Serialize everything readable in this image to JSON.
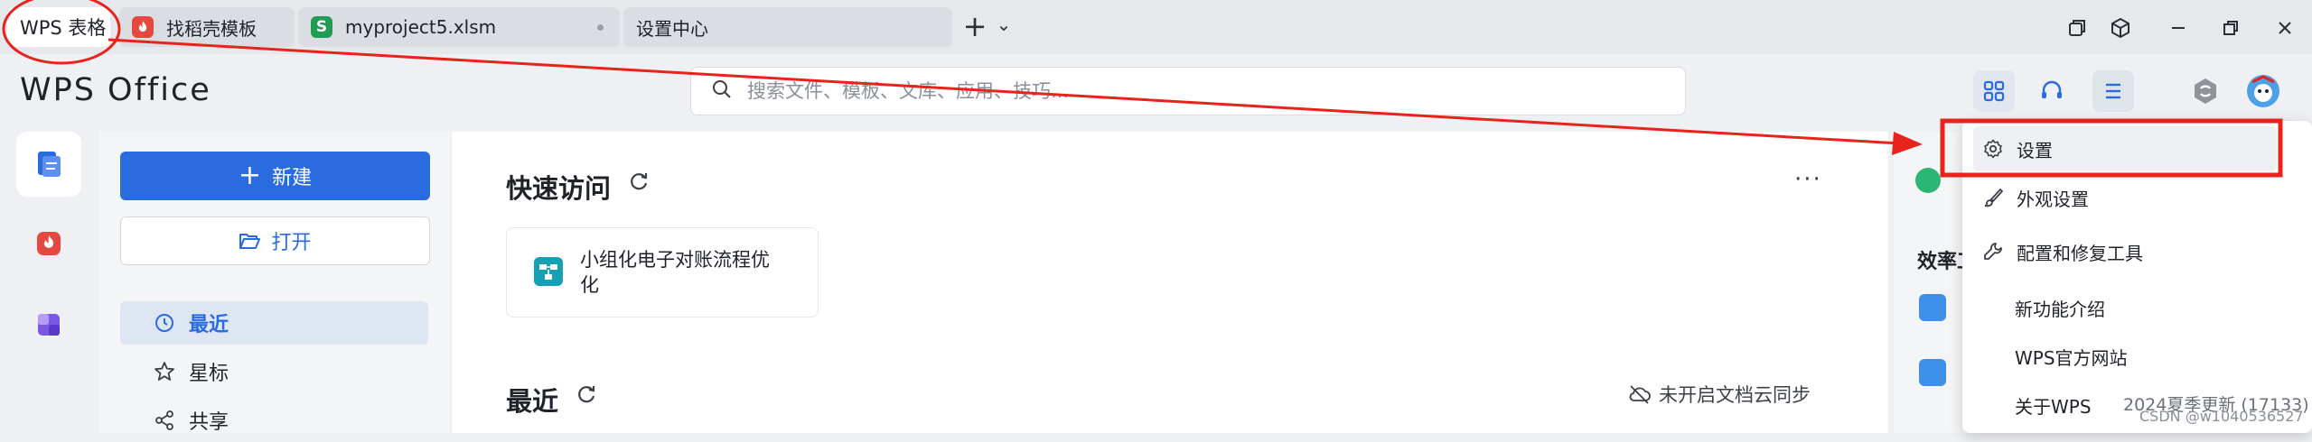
{
  "tabs": [
    {
      "label": "WPS 表格",
      "active": true
    },
    {
      "label": "找稻壳模板",
      "icon": "docer-icon",
      "color": "#e5483f"
    },
    {
      "label": "myproject5.xlsm",
      "icon": "S",
      "color": "#1f9d55"
    },
    {
      "label": "设置中心"
    }
  ],
  "tab_actions": {
    "add": "+",
    "dropdown": "⌄"
  },
  "app": {
    "logo": "WPS Office"
  },
  "search": {
    "placeholder": "搜索文件、模板、文库、应用、技巧..."
  },
  "left_panel": {
    "new_label": "新建",
    "open_label": "打开",
    "nav": [
      {
        "label": "最近",
        "active": true
      },
      {
        "label": "星标"
      },
      {
        "label": "共享"
      }
    ]
  },
  "main": {
    "quick_access_title": "快速访问",
    "quick_access_item": "小组化电子对账流程优化",
    "recent_title": "最近",
    "cloud_sync": "未开启文档云同步",
    "more": "···"
  },
  "right_panel": {
    "section": "效率工"
  },
  "menu": {
    "items": [
      {
        "label": "设置",
        "highlighted": true
      },
      {
        "label": "外观设置"
      },
      {
        "label": "配置和修复工具"
      },
      {
        "label": "新功能介绍"
      },
      {
        "label": "WPS官方网站"
      },
      {
        "label": "关于WPS"
      }
    ],
    "version": "2024夏季更新 (17133)"
  },
  "watermark": "CSDN @w1040536527",
  "colors": {
    "accent": "#2a6be0",
    "annotation": "#e8231b"
  }
}
